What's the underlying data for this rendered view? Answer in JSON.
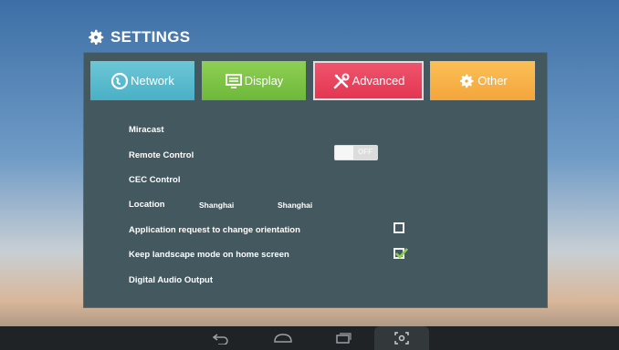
{
  "header": {
    "title": "SETTINGS",
    "icon": "gear-icon"
  },
  "tabs": [
    {
      "label": "Network",
      "icon": "globe-icon",
      "color": "#4ab0c6",
      "selected": false
    },
    {
      "label": "Display",
      "icon": "monitor-icon",
      "color": "#6db83a",
      "selected": false
    },
    {
      "label": "Advanced",
      "icon": "tools-icon",
      "color": "#e33450",
      "selected": true
    },
    {
      "label": "Other",
      "icon": "gear-icon",
      "color": "#f4a53c",
      "selected": false
    }
  ],
  "settings": {
    "miracast": "Miracast",
    "remote_control": {
      "label": "Remote Control",
      "state": "OFF"
    },
    "cec_control": "CEC Control",
    "location": {
      "label": "Location",
      "value1": "Shanghai",
      "value2": "Shanghai"
    },
    "orientation": {
      "label": "Application request to change orientation",
      "checked": false
    },
    "landscape": {
      "label": "Keep landscape mode on home screen",
      "checked": true
    },
    "digital_audio": "Digital Audio Output"
  },
  "navbar": {
    "buttons": [
      "back-icon",
      "home-icon",
      "recent-apps-icon",
      "screenshot-icon"
    ]
  },
  "colors": {
    "panel": "#43585f",
    "check": "#8ccf4a"
  }
}
